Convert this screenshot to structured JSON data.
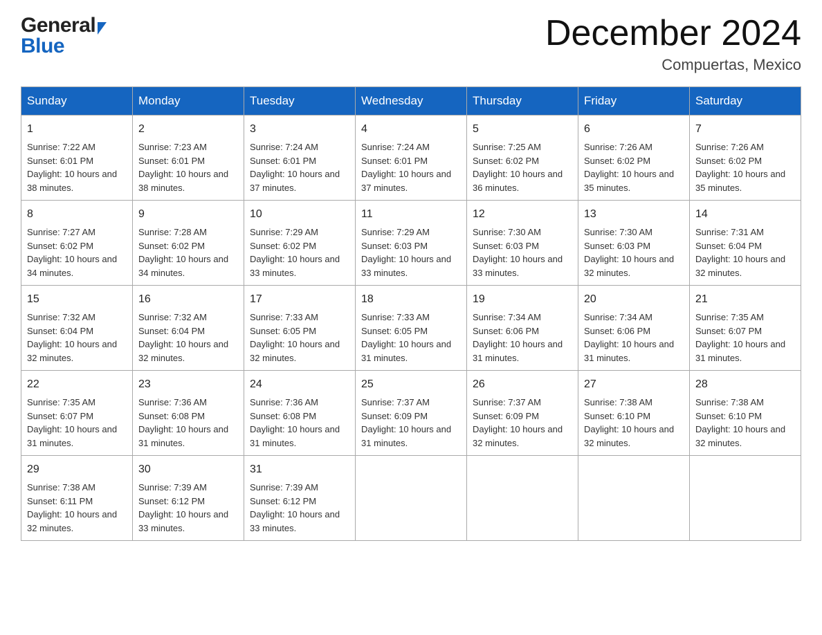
{
  "logo": {
    "general": "General",
    "blue": "Blue"
  },
  "title": "December 2024",
  "location": "Compuertas, Mexico",
  "weekdays": [
    "Sunday",
    "Monday",
    "Tuesday",
    "Wednesday",
    "Thursday",
    "Friday",
    "Saturday"
  ],
  "weeks": [
    [
      {
        "day": "1",
        "sunrise": "7:22 AM",
        "sunset": "6:01 PM",
        "daylight": "10 hours and 38 minutes."
      },
      {
        "day": "2",
        "sunrise": "7:23 AM",
        "sunset": "6:01 PM",
        "daylight": "10 hours and 38 minutes."
      },
      {
        "day": "3",
        "sunrise": "7:24 AM",
        "sunset": "6:01 PM",
        "daylight": "10 hours and 37 minutes."
      },
      {
        "day": "4",
        "sunrise": "7:24 AM",
        "sunset": "6:01 PM",
        "daylight": "10 hours and 37 minutes."
      },
      {
        "day": "5",
        "sunrise": "7:25 AM",
        "sunset": "6:02 PM",
        "daylight": "10 hours and 36 minutes."
      },
      {
        "day": "6",
        "sunrise": "7:26 AM",
        "sunset": "6:02 PM",
        "daylight": "10 hours and 35 minutes."
      },
      {
        "day": "7",
        "sunrise": "7:26 AM",
        "sunset": "6:02 PM",
        "daylight": "10 hours and 35 minutes."
      }
    ],
    [
      {
        "day": "8",
        "sunrise": "7:27 AM",
        "sunset": "6:02 PM",
        "daylight": "10 hours and 34 minutes."
      },
      {
        "day": "9",
        "sunrise": "7:28 AM",
        "sunset": "6:02 PM",
        "daylight": "10 hours and 34 minutes."
      },
      {
        "day": "10",
        "sunrise": "7:29 AM",
        "sunset": "6:02 PM",
        "daylight": "10 hours and 33 minutes."
      },
      {
        "day": "11",
        "sunrise": "7:29 AM",
        "sunset": "6:03 PM",
        "daylight": "10 hours and 33 minutes."
      },
      {
        "day": "12",
        "sunrise": "7:30 AM",
        "sunset": "6:03 PM",
        "daylight": "10 hours and 33 minutes."
      },
      {
        "day": "13",
        "sunrise": "7:30 AM",
        "sunset": "6:03 PM",
        "daylight": "10 hours and 32 minutes."
      },
      {
        "day": "14",
        "sunrise": "7:31 AM",
        "sunset": "6:04 PM",
        "daylight": "10 hours and 32 minutes."
      }
    ],
    [
      {
        "day": "15",
        "sunrise": "7:32 AM",
        "sunset": "6:04 PM",
        "daylight": "10 hours and 32 minutes."
      },
      {
        "day": "16",
        "sunrise": "7:32 AM",
        "sunset": "6:04 PM",
        "daylight": "10 hours and 32 minutes."
      },
      {
        "day": "17",
        "sunrise": "7:33 AM",
        "sunset": "6:05 PM",
        "daylight": "10 hours and 32 minutes."
      },
      {
        "day": "18",
        "sunrise": "7:33 AM",
        "sunset": "6:05 PM",
        "daylight": "10 hours and 31 minutes."
      },
      {
        "day": "19",
        "sunrise": "7:34 AM",
        "sunset": "6:06 PM",
        "daylight": "10 hours and 31 minutes."
      },
      {
        "day": "20",
        "sunrise": "7:34 AM",
        "sunset": "6:06 PM",
        "daylight": "10 hours and 31 minutes."
      },
      {
        "day": "21",
        "sunrise": "7:35 AM",
        "sunset": "6:07 PM",
        "daylight": "10 hours and 31 minutes."
      }
    ],
    [
      {
        "day": "22",
        "sunrise": "7:35 AM",
        "sunset": "6:07 PM",
        "daylight": "10 hours and 31 minutes."
      },
      {
        "day": "23",
        "sunrise": "7:36 AM",
        "sunset": "6:08 PM",
        "daylight": "10 hours and 31 minutes."
      },
      {
        "day": "24",
        "sunrise": "7:36 AM",
        "sunset": "6:08 PM",
        "daylight": "10 hours and 31 minutes."
      },
      {
        "day": "25",
        "sunrise": "7:37 AM",
        "sunset": "6:09 PM",
        "daylight": "10 hours and 31 minutes."
      },
      {
        "day": "26",
        "sunrise": "7:37 AM",
        "sunset": "6:09 PM",
        "daylight": "10 hours and 32 minutes."
      },
      {
        "day": "27",
        "sunrise": "7:38 AM",
        "sunset": "6:10 PM",
        "daylight": "10 hours and 32 minutes."
      },
      {
        "day": "28",
        "sunrise": "7:38 AM",
        "sunset": "6:10 PM",
        "daylight": "10 hours and 32 minutes."
      }
    ],
    [
      {
        "day": "29",
        "sunrise": "7:38 AM",
        "sunset": "6:11 PM",
        "daylight": "10 hours and 32 minutes."
      },
      {
        "day": "30",
        "sunrise": "7:39 AM",
        "sunset": "6:12 PM",
        "daylight": "10 hours and 33 minutes."
      },
      {
        "day": "31",
        "sunrise": "7:39 AM",
        "sunset": "6:12 PM",
        "daylight": "10 hours and 33 minutes."
      },
      null,
      null,
      null,
      null
    ]
  ],
  "labels": {
    "sunrise": "Sunrise:",
    "sunset": "Sunset:",
    "daylight": "Daylight:"
  }
}
